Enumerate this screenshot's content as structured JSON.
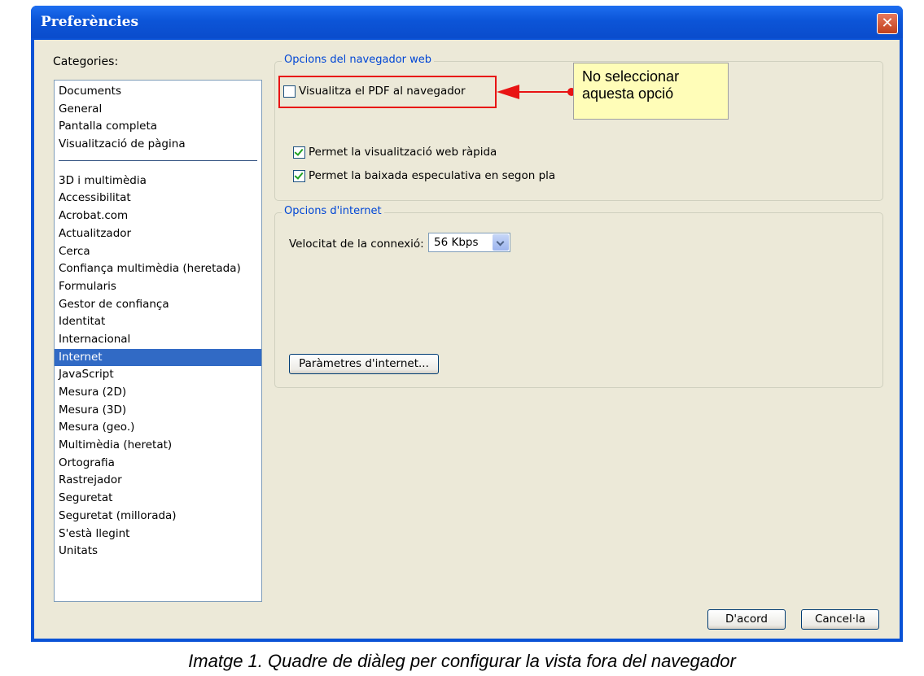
{
  "window": {
    "title": "Preferències",
    "close_glyph": "✕"
  },
  "categories": {
    "label": "Categories:",
    "top_items": [
      "Documents",
      "General",
      "Pantalla completa",
      "Visualització de pàgina"
    ],
    "items": [
      "3D i multimèdia",
      "Accessibilitat",
      "Acrobat.com",
      "Actualitzador",
      "Cerca",
      "Confiança multimèdia (heretada)",
      "Formularis",
      "Gestor de confiança",
      "Identitat",
      "Internacional",
      "Internet",
      "JavaScript",
      "Mesura (2D)",
      "Mesura (3D)",
      "Mesura (geo.)",
      "Multimèdia (heretat)",
      "Ortografia",
      "Rastrejador",
      "Seguretat",
      "Seguretat (millorada)",
      "S'està llegint",
      "Unitats"
    ],
    "selected": "Internet"
  },
  "browser_group": {
    "legend": "Opcions del navegador web",
    "view_pdf_label": "Visualitza el PDF al navegador",
    "view_pdf_checked": false,
    "fast_web_label": "Permet la visualització web ràpida",
    "fast_web_checked": true,
    "speculative_label": "Permet la baixada especulativa en segon pla",
    "speculative_checked": true
  },
  "internet_group": {
    "legend": "Opcions d'internet",
    "speed_label": "Velocitat de la connexió:",
    "speed_value": "56 Kbps",
    "settings_button": "Paràmetres d'internet..."
  },
  "annotation": {
    "note_line1": "No seleccionar",
    "note_line2": "aquesta opció",
    "color": "#e81414",
    "note_bg": "#fffdb8"
  },
  "buttons": {
    "ok": "D'acord",
    "cancel": "Cancel·la"
  },
  "caption": "Imatge 1. Quadre de diàleg per configurar la vista fora del navegador",
  "colors": {
    "titlebar": "#0c55d8",
    "dialog_bg": "#ece9d8",
    "selection": "#316ac5",
    "legend_text": "#0046d5"
  }
}
